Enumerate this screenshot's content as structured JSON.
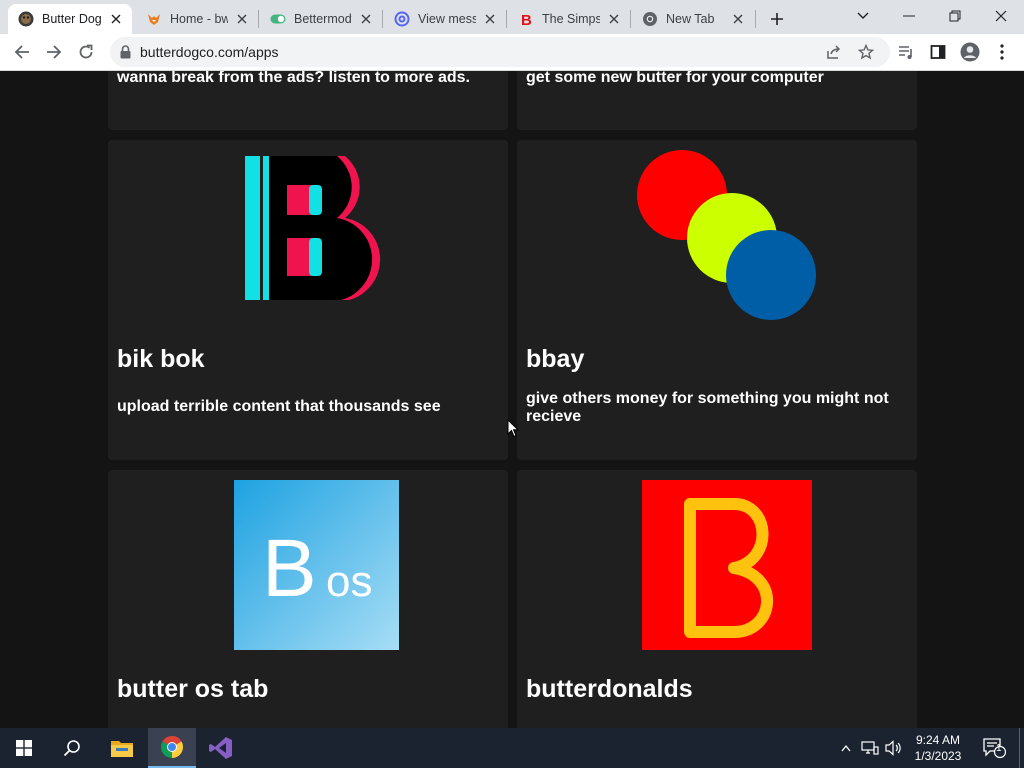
{
  "browser": {
    "tabs": [
      {
        "title": "Butter Dog",
        "icon": "butterdog-favicon",
        "active": true
      },
      {
        "title": "Home - bw",
        "icon": "fox-favicon"
      },
      {
        "title": "Bettermodv",
        "icon": "toggle-favicon"
      },
      {
        "title": "View mess",
        "icon": "at-sign-favicon"
      },
      {
        "title": "The Simpso",
        "icon": "b-favicon"
      },
      {
        "title": "New Tab",
        "icon": "chrome-favicon"
      }
    ],
    "url": "butterdogco.com/apps"
  },
  "apps": {
    "top_left_desc": "wanna break from the ads? listen to more ads.",
    "top_right_desc": "get some new butter for your computer",
    "cards": [
      {
        "title": "bik bok",
        "desc": "upload terrible content that thousands see",
        "logo": "bikbok-logo"
      },
      {
        "title": "bbay",
        "desc": "give others money for something you might not recieve",
        "logo": "bbay-logo"
      },
      {
        "title": "butter os tab",
        "desc": "",
        "logo": "butter-os-logo",
        "logo_text_big": "B",
        "logo_text_small": "os"
      },
      {
        "title": "butterdonalds",
        "desc": "",
        "logo": "butterdonalds-logo"
      }
    ]
  },
  "taskbar": {
    "time": "9:24 AM",
    "date": "1/3/2023",
    "notification_count": "1"
  },
  "colors": {
    "page_bg": "#141414",
    "card_bg": "#1f1f1f",
    "bikbok_cyan": "#11e1e4",
    "bikbok_pink": "#f0144e",
    "bbay_red": "#ff0000",
    "bbay_yellow": "#ccff00",
    "bbay_blue": "#005ea6",
    "butterdonalds_red": "#ff0000",
    "butterdonalds_yellow": "#ffc20e"
  }
}
